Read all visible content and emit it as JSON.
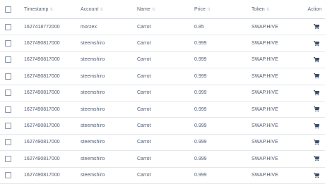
{
  "headers": {
    "timestamp": "Timestamp",
    "account": "Account",
    "name": "Name",
    "price": "Price",
    "token": "Token",
    "action": "Action"
  },
  "rows": [
    {
      "timestamp": "1627418772000",
      "account": "morzex",
      "name": "Carrot",
      "price": "0.85",
      "token": "SWAP.HIVE"
    },
    {
      "timestamp": "1627490817000",
      "account": "steemshiro",
      "name": "Carrot",
      "price": "0.999",
      "token": "SWAP.HIVE"
    },
    {
      "timestamp": "1627490817000",
      "account": "steemshiro",
      "name": "Carrot",
      "price": "0.999",
      "token": "SWAP.HIVE"
    },
    {
      "timestamp": "1627490817000",
      "account": "steemshiro",
      "name": "Carrot",
      "price": "0.999",
      "token": "SWAP.HIVE"
    },
    {
      "timestamp": "1627490817000",
      "account": "steemshiro",
      "name": "Carrot",
      "price": "0.999",
      "token": "SWAP.HIVE"
    },
    {
      "timestamp": "1627490817000",
      "account": "steemshiro",
      "name": "Carrot",
      "price": "0.999",
      "token": "SWAP.HIVE"
    },
    {
      "timestamp": "1627490817000",
      "account": "steemshiro",
      "name": "Carrot",
      "price": "0.999",
      "token": "SWAP.HIVE"
    },
    {
      "timestamp": "1627490817000",
      "account": "steemshiro",
      "name": "Carrot",
      "price": "0.999",
      "token": "SWAP.HIVE"
    },
    {
      "timestamp": "1627490817000",
      "account": "steemshiro",
      "name": "Carrot",
      "price": "0.999",
      "token": "SWAP.HIVE"
    },
    {
      "timestamp": "1627490817000",
      "account": "steemshiro",
      "name": "Carrot",
      "price": "0.999",
      "token": "SWAP.HIVE"
    }
  ],
  "icons": {
    "action": "shopping-cart-icon",
    "sort": "sort-arrows-icon"
  },
  "colors": {
    "text": "#4f5d73",
    "icon": "#3c4b64",
    "border": "#e4e7ea"
  }
}
